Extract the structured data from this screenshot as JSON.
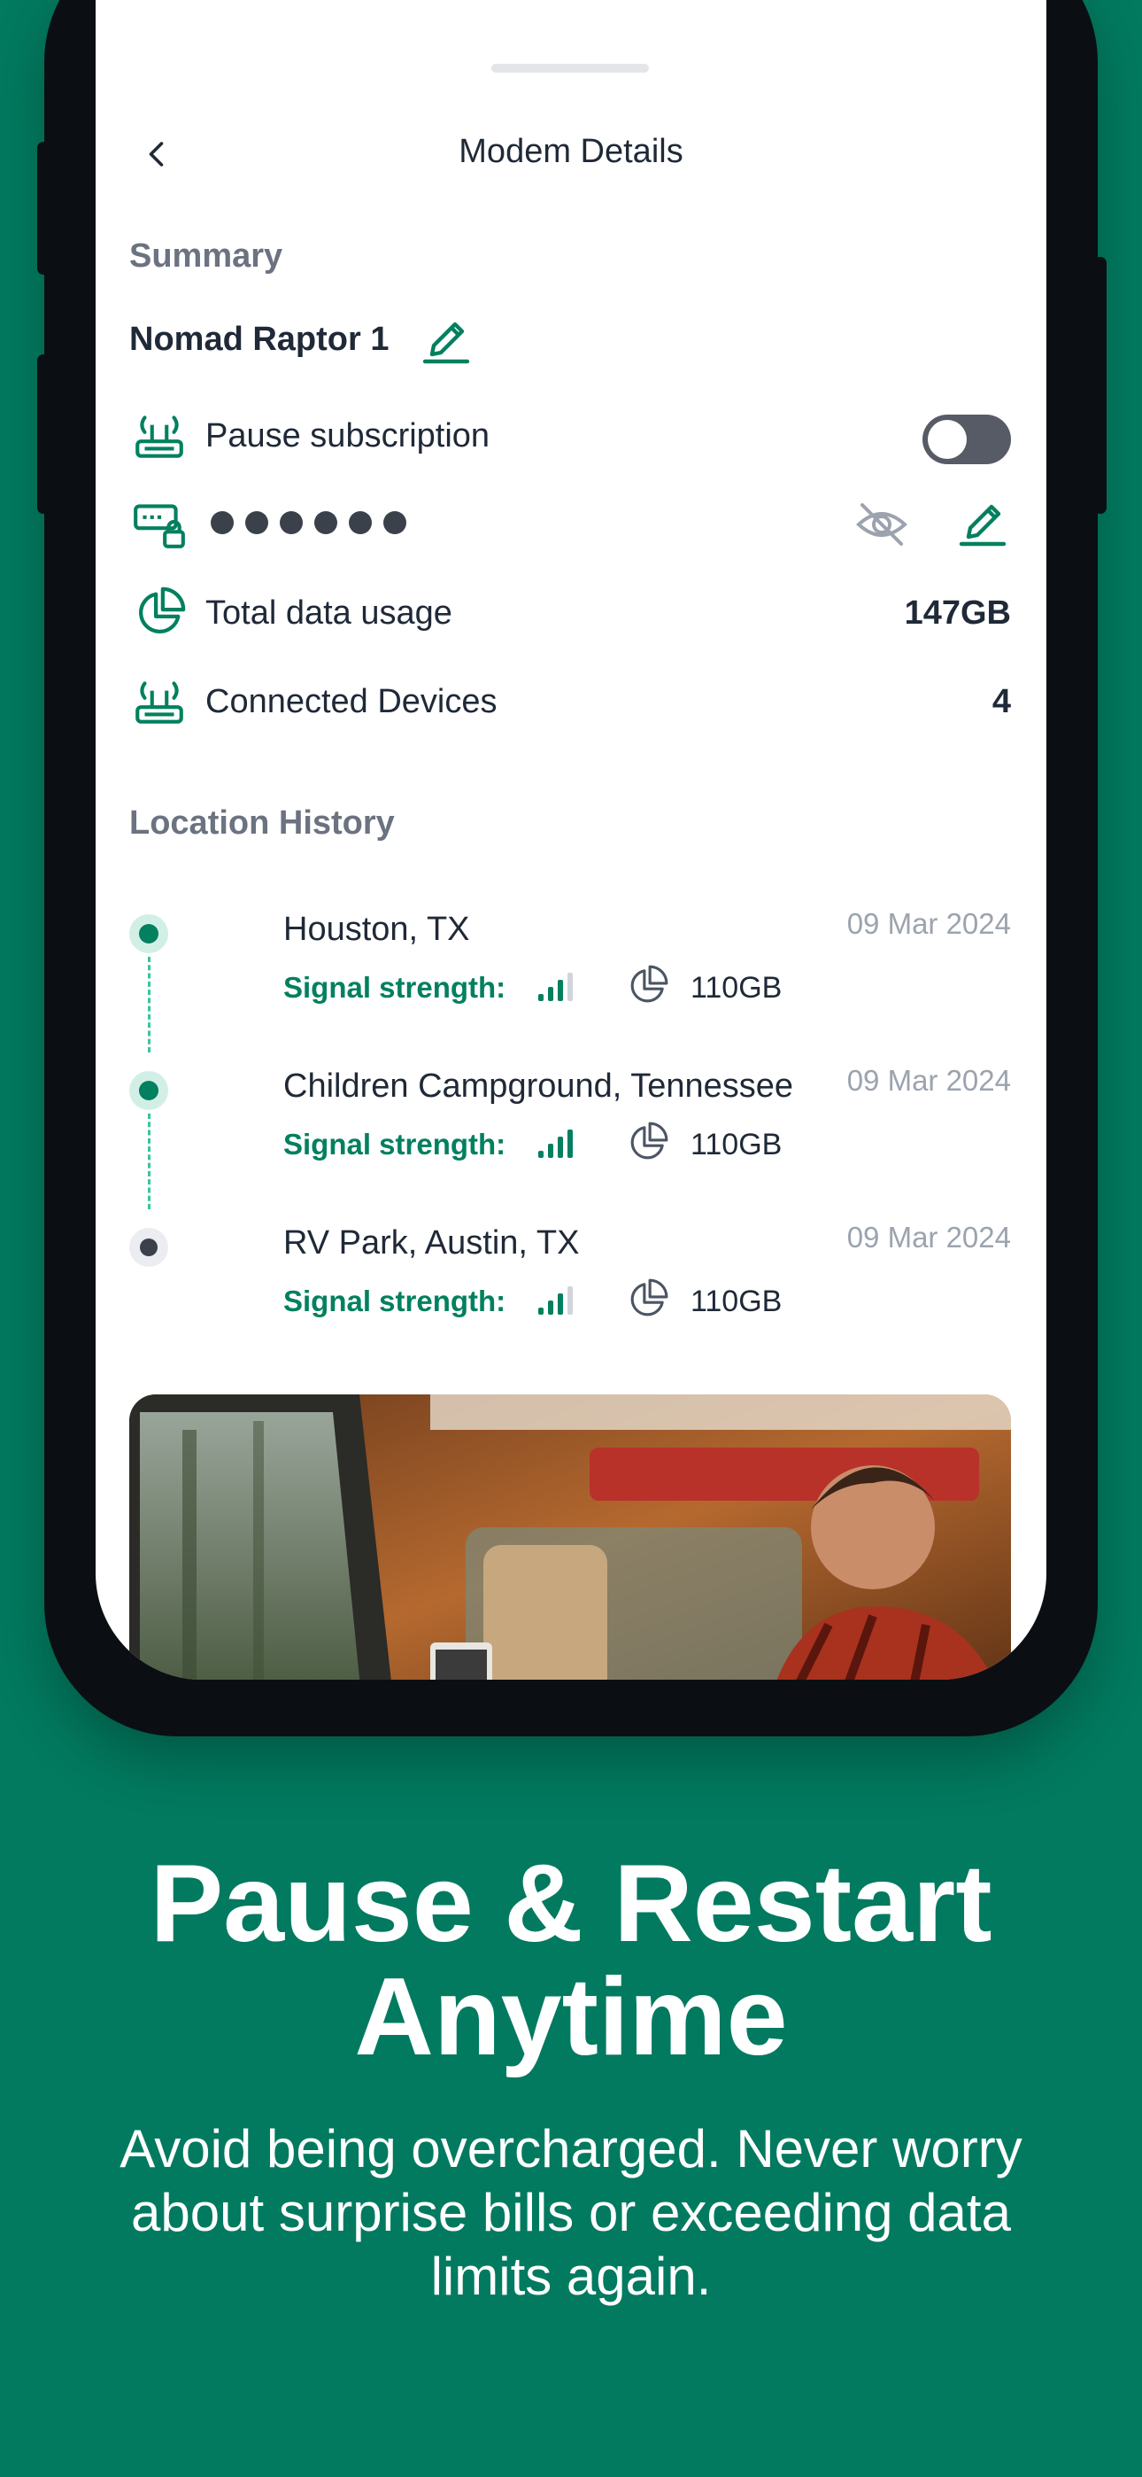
{
  "nav": {
    "title": "Modem Details"
  },
  "summary": {
    "section_title": "Summary",
    "device_name": "Nomad Raptor 1",
    "pause_label": "Pause subscription",
    "pause_enabled": false,
    "password_mask": "••••••",
    "data_usage_label": "Total data usage",
    "data_usage_value": "147GB",
    "devices_label": "Connected Devices",
    "devices_value": "4"
  },
  "location_history": {
    "section_title": "Location History",
    "entries": [
      {
        "place": "Houston, TX",
        "date": "09 Mar 2024",
        "signal_label": "Signal strength:",
        "signal_bars": 3,
        "usage": "110GB",
        "active": true
      },
      {
        "place": "Children Campground, Tennessee",
        "date": "09 Mar 2024",
        "signal_label": "Signal strength:",
        "signal_bars": 4,
        "usage": "110GB",
        "active": true
      },
      {
        "place": "RV Park, Austin, TX",
        "date": "09 Mar 2024",
        "signal_label": "Signal strength:",
        "signal_bars": 3,
        "usage": "110GB",
        "active": false
      }
    ]
  },
  "promo": {
    "headline_line1": "Pause & Restart",
    "headline_line2": "Anytime",
    "subtext": "Avoid being overcharged. Never worry about surprise bills or exceeding data limits again."
  },
  "colors": {
    "brand_green": "#027a5f",
    "accent_green": "#02805f",
    "text_dark": "#1f2937",
    "text_muted": "#6b7280"
  },
  "icons": [
    "chevron-left-icon",
    "pencil-icon",
    "router-icon",
    "password-icon",
    "eye-off-icon",
    "pie-chart-icon",
    "signal-bars-icon"
  ]
}
